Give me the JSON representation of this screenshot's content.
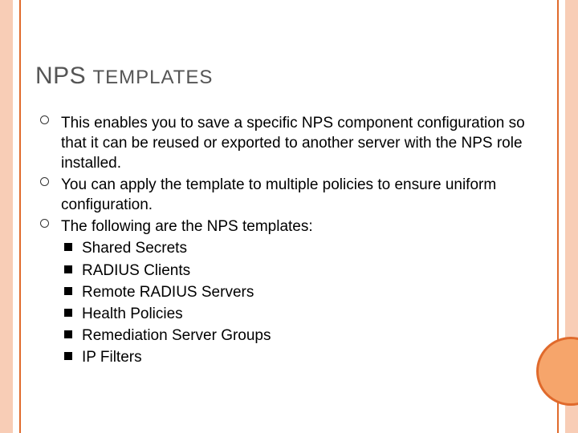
{
  "title": {
    "word1": "NPS",
    "rest": "TEMPLATES"
  },
  "bullets": [
    {
      "text": "This enables you to save a specific NPS component configuration so that it can be reused or exported to another server with the NPS role installed."
    },
    {
      "text": "You can apply the template to multiple policies to ensure uniform configuration."
    },
    {
      "text": "The following are the NPS templates:",
      "subs": [
        "Shared Secrets",
        "RADIUS Clients",
        "Remote RADIUS Servers",
        "Health Policies",
        "Remediation Server Groups",
        "IP Filters"
      ]
    }
  ]
}
